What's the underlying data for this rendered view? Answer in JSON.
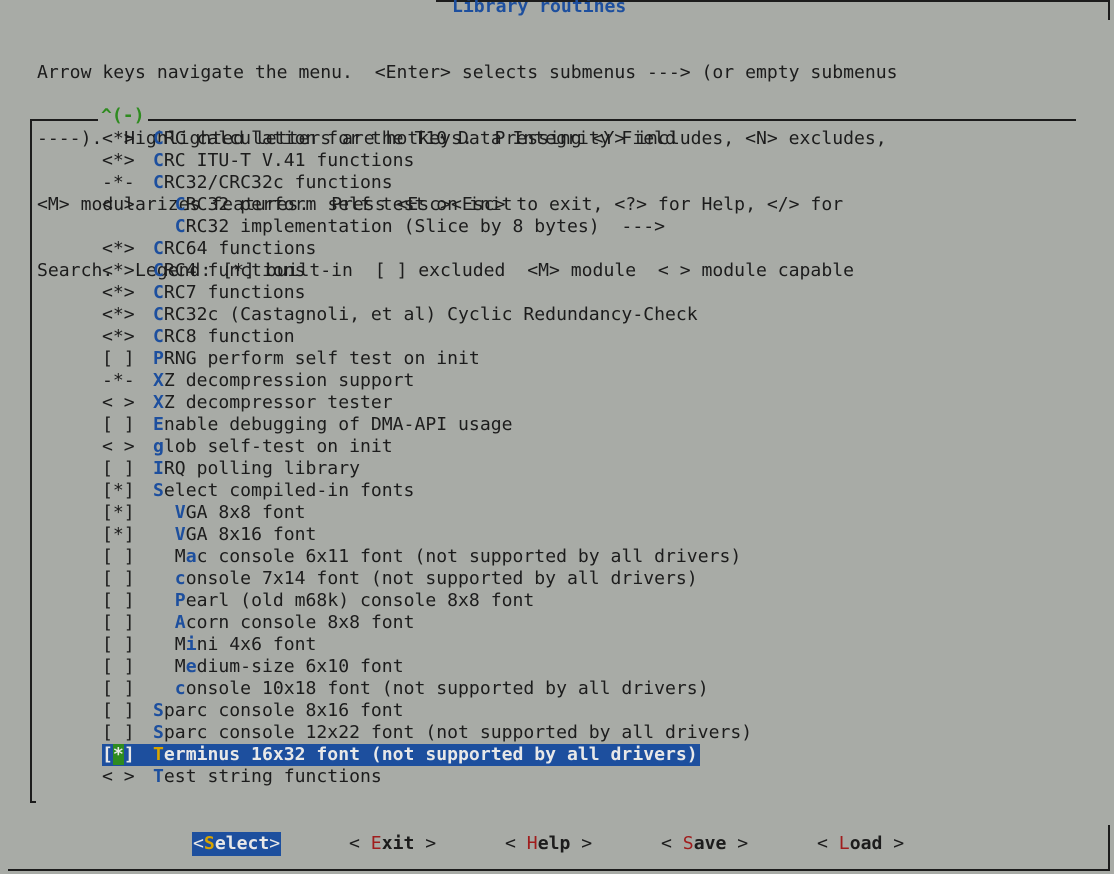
{
  "window": {
    "title": "Library routines"
  },
  "help_lines": [
    "Arrow keys navigate the menu.  <Enter> selects submenus ---> (or empty submenus",
    "----).  Highlighted letters are hotkeys.  Pressing <Y> includes, <N> excludes,",
    "<M> modularizes features.  Press <Esc><Esc> to exit, <?> for Help, </> for",
    "Search.  Legend: [*] built-in  [ ] excluded  <M> module  < > module capable"
  ],
  "scroll_indicator": "^(-)",
  "items": [
    {
      "state": "<*>",
      "hotkey": "C",
      "rest": "RC calculation for the T10 Data Integrity Field",
      "indent": false
    },
    {
      "state": "<*>",
      "hotkey": "C",
      "rest": "RC ITU-T V.41 functions",
      "indent": false
    },
    {
      "state": "-*-",
      "hotkey": "C",
      "rest": "RC32/CRC32c functions",
      "indent": false
    },
    {
      "state": "< >",
      "hotkey": "C",
      "rest": "RC32 perform self test on init",
      "indent": true
    },
    {
      "state": "",
      "hotkey": "C",
      "rest": "RC32 implementation (Slice by 8 bytes)  --->",
      "indent": true
    },
    {
      "state": "<*>",
      "hotkey": "C",
      "rest": "RC64 functions",
      "indent": false
    },
    {
      "state": "<*>",
      "hotkey": "C",
      "rest": "RC4 functions",
      "indent": false
    },
    {
      "state": "<*>",
      "hotkey": "C",
      "rest": "RC7 functions",
      "indent": false
    },
    {
      "state": "<*>",
      "hotkey": "C",
      "rest": "RC32c (Castagnoli, et al) Cyclic Redundancy-Check",
      "indent": false
    },
    {
      "state": "<*>",
      "hotkey": "C",
      "rest": "RC8 function",
      "indent": false
    },
    {
      "state": "[ ]",
      "hotkey": "P",
      "rest": "RNG perform self test on init",
      "indent": false
    },
    {
      "state": "-*-",
      "hotkey": "X",
      "rest": "Z decompression support",
      "indent": false
    },
    {
      "state": "< >",
      "hotkey": "X",
      "rest": "Z decompressor tester",
      "indent": false
    },
    {
      "state": "[ ]",
      "hotkey": "E",
      "rest": "nable debugging of DMA-API usage",
      "indent": false
    },
    {
      "state": "< >",
      "hotkey": "g",
      "rest": "lob self-test on init",
      "indent": false
    },
    {
      "state": "[ ]",
      "hotkey": "I",
      "rest": "RQ polling library",
      "indent": false
    },
    {
      "state": "[*]",
      "hotkey": "S",
      "rest": "elect compiled-in fonts",
      "indent": false
    },
    {
      "state": "[*]",
      "hotkey": "V",
      "rest": "GA 8x8 font",
      "indent": true
    },
    {
      "state": "[*]",
      "hotkey": "V",
      "rest": "GA 8x16 font",
      "indent": true
    },
    {
      "state": "[ ]",
      "pre": "M",
      "hotkey": "a",
      "rest": "c console 6x11 font (not supported by all drivers)",
      "indent": true
    },
    {
      "state": "[ ]",
      "hotkey": "c",
      "rest": "onsole 7x14 font (not supported by all drivers)",
      "indent": true
    },
    {
      "state": "[ ]",
      "hotkey": "P",
      "rest": "earl (old m68k) console 8x8 font",
      "indent": true
    },
    {
      "state": "[ ]",
      "hotkey": "A",
      "rest": "corn console 8x8 font",
      "indent": true
    },
    {
      "state": "[ ]",
      "pre": "M",
      "hotkey": "i",
      "rest": "ni 4x6 font",
      "indent": true
    },
    {
      "state": "[ ]",
      "pre": "M",
      "hotkey": "e",
      "rest": "dium-size 6x10 font",
      "indent": true
    },
    {
      "state": "[ ]",
      "hotkey": "c",
      "rest": "onsole 10x18 font (not supported by all drivers)",
      "indent": true
    },
    {
      "state": "[ ]",
      "hotkey": "S",
      "rest": "parc console 8x16 font",
      "indent": false
    },
    {
      "state": "[ ]",
      "hotkey": "S",
      "rest": "parc console 12x22 font (not supported by all drivers)",
      "indent": false
    },
    {
      "state": "[*]",
      "hotkey": "T",
      "rest": "erminus 16x32 font (not supported by all drivers)",
      "indent": false,
      "selected": true
    },
    {
      "state": "< >",
      "hotkey": "T",
      "rest": "est string functions",
      "indent": false
    }
  ],
  "buttons": [
    {
      "open": "<",
      "hotkey": "S",
      "rest": "elect",
      "close": ">",
      "active": true
    },
    {
      "open": "< ",
      "hotkey": "E",
      "rest": "xit",
      "close": " >"
    },
    {
      "open": "< ",
      "hotkey": "H",
      "rest": "elp",
      "close": " >"
    },
    {
      "open": "< ",
      "hotkey": "S",
      "rest": "ave",
      "close": " >"
    },
    {
      "open": "< ",
      "hotkey": "L",
      "rest": "oad",
      "close": " >"
    }
  ],
  "colors": {
    "background": "#a8aba6",
    "accent": "#1d4f9e",
    "hotkey_button": "#a01d1d",
    "scroll": "#2e8b1f"
  }
}
